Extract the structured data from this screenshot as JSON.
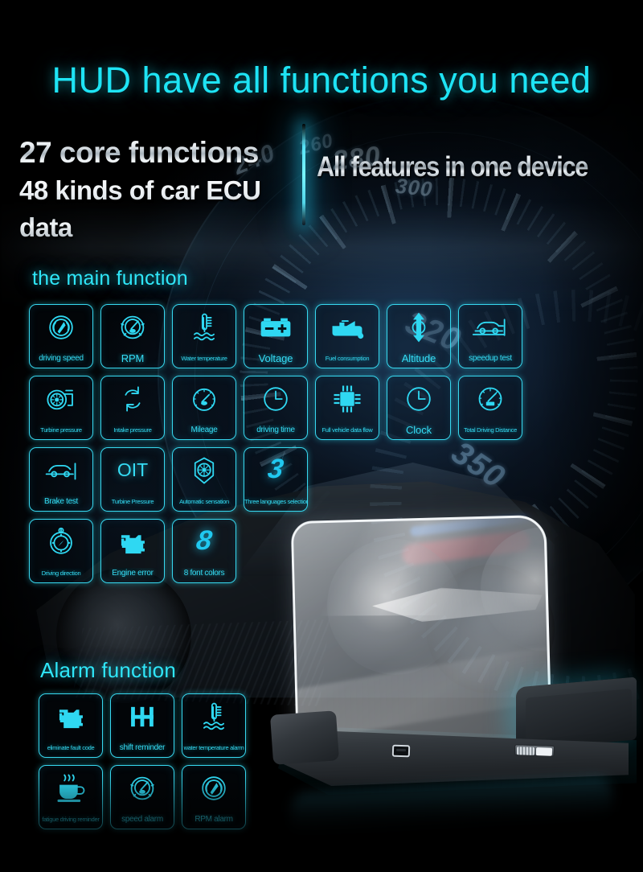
{
  "header": {
    "headline": "HUD have all functions you need",
    "stat_line_1": "27 core functions",
    "stat_line_2": "48 kinds of car ECU data",
    "tagline": "All features in one device"
  },
  "sections": {
    "main_title": "the main function",
    "alarm_title": "Alarm function"
  },
  "main_functions": [
    [
      {
        "label": "driving speed",
        "icon": "speedometer-icon",
        "size": "small"
      },
      {
        "label": "RPM",
        "icon": "tachometer-icon",
        "size": "big"
      },
      {
        "label": "Water temperature",
        "icon": "water-temperature-icon",
        "size": "xtiny"
      },
      {
        "label": "Voltage",
        "icon": "battery-icon",
        "size": "big"
      },
      {
        "label": "Fuel consumption",
        "icon": "oil-can-icon",
        "size": "xtiny"
      },
      {
        "label": "Altitude",
        "icon": "altitude-arrows-icon",
        "size": "big"
      },
      {
        "label": "speedup test",
        "icon": "car-acceleration-icon",
        "size": "small"
      }
    ],
    [
      {
        "label": "Turbine pressure",
        "icon": "turbocharger-icon",
        "size": "xtiny"
      },
      {
        "label": "Intake pressure",
        "icon": "recycle-arrows-icon",
        "size": "xtiny"
      },
      {
        "label": "Mileage",
        "icon": "gauge-icon",
        "size": "small"
      },
      {
        "label": "driving time",
        "icon": "clock-icon",
        "size": "small"
      },
      {
        "label": "Full vehicle data flow",
        "icon": "chip-icon",
        "size": "xtiny"
      },
      {
        "label": "Clock",
        "icon": "clock-icon",
        "size": "big"
      },
      {
        "label": "Total Driving Distance",
        "icon": "odometer-icon",
        "size": "xtiny"
      }
    ],
    [
      {
        "label": "Brake test",
        "icon": "car-brake-icon",
        "size": "small"
      },
      {
        "label": "Turbine Pressure",
        "icon": "oit-text-icon",
        "size": "xtiny",
        "bigtext": "OIT"
      },
      {
        "label": "Automatic sensation",
        "icon": "auto-sensor-icon",
        "size": "xtiny"
      },
      {
        "label": "Three languages selection",
        "icon": "number-three-icon",
        "size": "xtiny",
        "numglyph": "3"
      }
    ],
    [
      {
        "label": "Driving direction",
        "icon": "compass-icon",
        "size": "xtiny"
      },
      {
        "label": "Engine error",
        "icon": "engine-icon",
        "size": "small"
      },
      {
        "label": "8 font colors",
        "icon": "number-eight-icon",
        "size": "small",
        "numglyph": "8"
      }
    ]
  ],
  "alarm_functions": [
    [
      {
        "label": "eliminate fault code",
        "icon": "engine-icon",
        "size": "xtiny"
      },
      {
        "label": "shift reminder",
        "icon": "shift-gear-icon",
        "size": "small"
      },
      {
        "label": "water temperature alarm",
        "icon": "water-temperature-icon",
        "size": "xtiny"
      }
    ],
    [
      {
        "label": "fatigue driving reminder",
        "icon": "coffee-cup-icon",
        "size": "xtiny"
      },
      {
        "label": "speed alarm",
        "icon": "tachometer-icon",
        "size": "small"
      },
      {
        "label": "RPM alarm",
        "icon": "speedometer-icon",
        "size": "small"
      }
    ]
  ],
  "background": {
    "dial_numbers": [
      "240",
      "260",
      "280",
      "300",
      "320",
      "350"
    ],
    "accent_color": "#2fd8f2",
    "headline_color": "#1ee4f5"
  }
}
